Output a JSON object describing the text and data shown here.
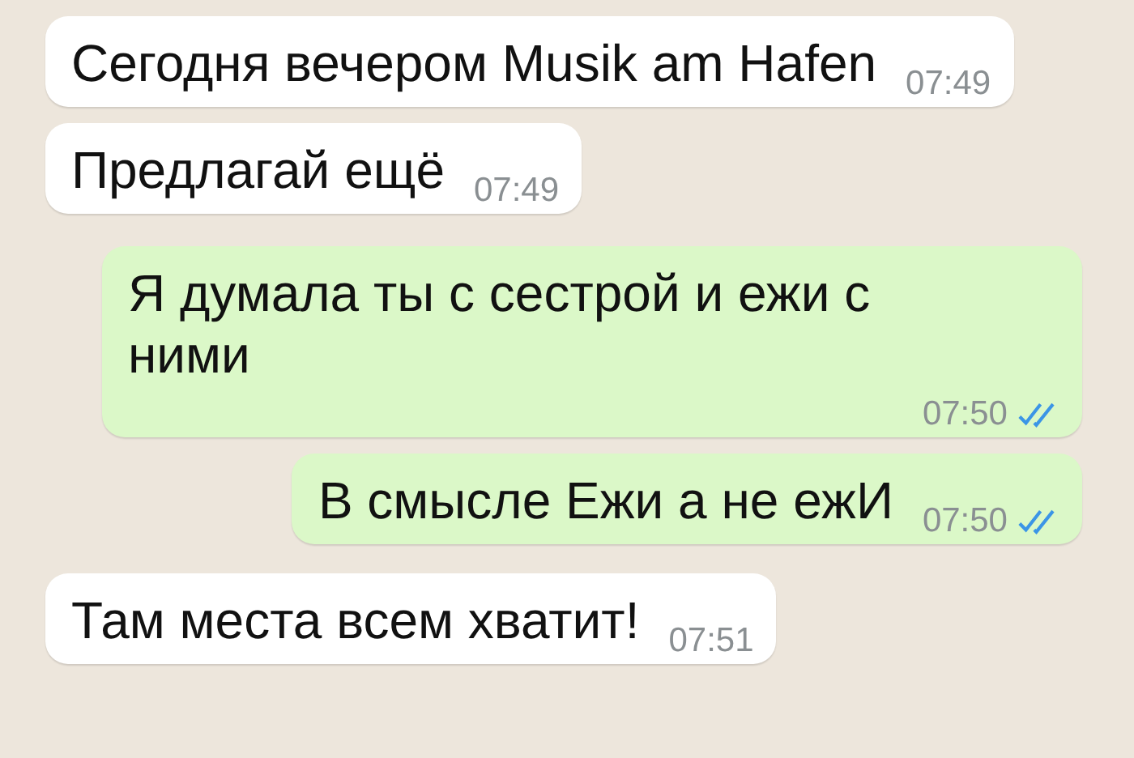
{
  "messages": [
    {
      "kind": "incoming",
      "text": "Сегодня вечером Musik am Hafen",
      "time": "07:49"
    },
    {
      "kind": "incoming",
      "text": "Предлагай ещё",
      "time": "07:49"
    },
    {
      "kind": "outgoing",
      "text": "Я думала ты с сестрой и ежи с ними",
      "time": "07:50",
      "read": true
    },
    {
      "kind": "outgoing",
      "text": "В смысле Ежи а не ежИ",
      "time": "07:50",
      "read": true
    },
    {
      "kind": "incoming",
      "text": "Там места всем хватит!",
      "time": "07:51"
    }
  ]
}
